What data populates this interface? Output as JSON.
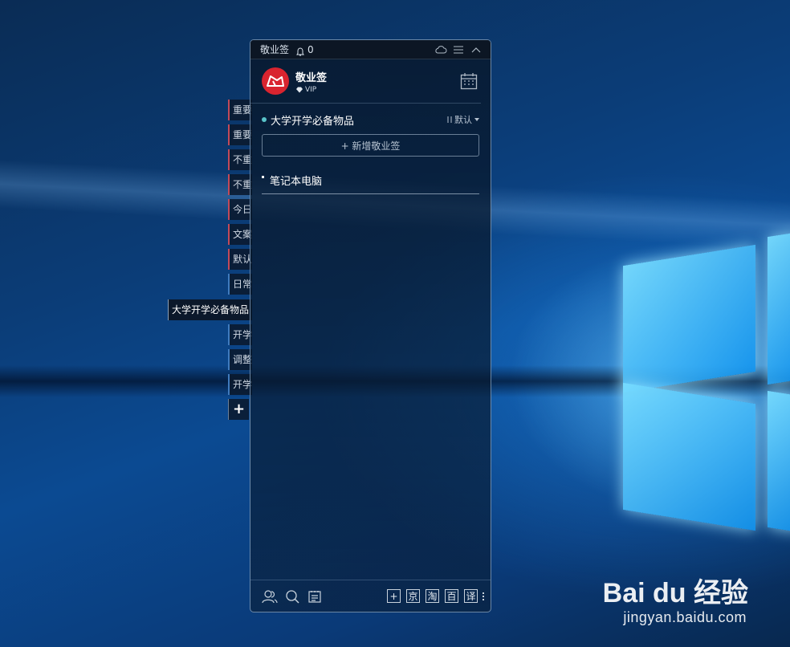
{
  "window": {
    "title": "敬业签",
    "notification_count": "0"
  },
  "user": {
    "name": "敬业签",
    "badge": "VIP"
  },
  "side_tabs": [
    {
      "label": "重要",
      "color": "red"
    },
    {
      "label": "重要",
      "color": "red"
    },
    {
      "label": "不重",
      "color": "red"
    },
    {
      "label": "不重",
      "color": "red"
    },
    {
      "label": "今日",
      "color": "red"
    },
    {
      "label": "文案",
      "color": "red"
    },
    {
      "label": "默认",
      "color": "red"
    },
    {
      "label": "日常",
      "color": "blue"
    },
    {
      "label": "大学开学必备物品",
      "color": "active"
    },
    {
      "label": "开学",
      "color": "blue"
    },
    {
      "label": "调整",
      "color": "blue"
    },
    {
      "label": "开学",
      "color": "blue"
    },
    {
      "label": "+",
      "color": "add"
    }
  ],
  "category": {
    "title": "大学开学必备物品",
    "sort_label": "默认",
    "accent_color": "#59c3c9"
  },
  "add_button": {
    "label": "+ 新增敬业签"
  },
  "notes": [
    {
      "text": "笔记本电脑"
    }
  ],
  "footer": {
    "shortcuts": [
      "京",
      "淘",
      "百",
      "译"
    ]
  },
  "watermark": {
    "brand": "Bai du 经验",
    "url": "jingyan.baidu.com"
  }
}
